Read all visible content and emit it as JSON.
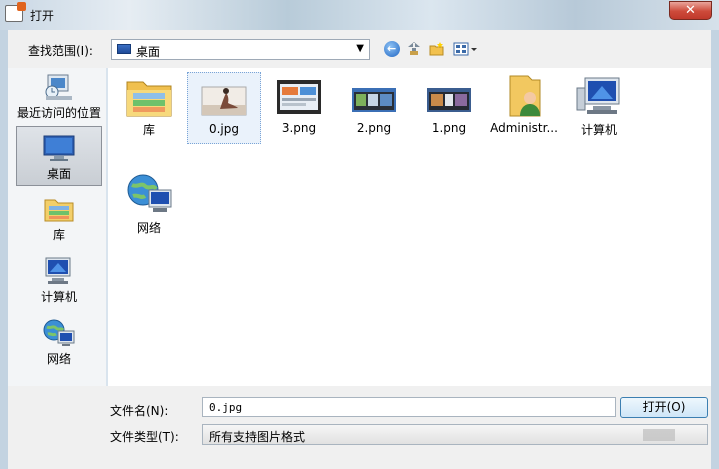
{
  "window": {
    "title": "打开",
    "close_glyph": "✕"
  },
  "toolbar": {
    "look_in_label": "查找范围(I):",
    "look_in_value": "桌面",
    "dropdown_glyph": "▼",
    "view_glyph": "▾"
  },
  "sidebar": {
    "items": [
      {
        "label": "最近访问的位置",
        "icon": "recent-places-icon"
      },
      {
        "label": "桌面",
        "icon": "desktop-icon",
        "selected": true
      },
      {
        "label": "库",
        "icon": "libraries-icon"
      },
      {
        "label": "计算机",
        "icon": "computer-icon"
      },
      {
        "label": "网络",
        "icon": "network-icon"
      }
    ]
  },
  "files": [
    {
      "label": "库",
      "icon": "libraries-folder-icon"
    },
    {
      "label": "0.jpg",
      "icon": "image-thumbnail-icon",
      "selected": true
    },
    {
      "label": "3.png",
      "icon": "image-thumbnail-icon"
    },
    {
      "label": "2.png",
      "icon": "image-thumbnail-icon"
    },
    {
      "label": "1.png",
      "icon": "image-thumbnail-icon"
    },
    {
      "label": "Administr...",
      "icon": "user-folder-icon"
    },
    {
      "label": "计算机",
      "icon": "computer-icon"
    },
    {
      "label": "网络",
      "icon": "network-icon"
    }
  ],
  "bottom": {
    "filename_label": "文件名(N):",
    "filename_value": "0.jpg",
    "open_button": "打开(O)",
    "filetype_label": "文件类型(T):",
    "filetype_value": "所有支持图片格式"
  },
  "colors": {
    "accent": "#3c7fb1",
    "close": "#c0392b",
    "selection": "#7aa4d6"
  }
}
